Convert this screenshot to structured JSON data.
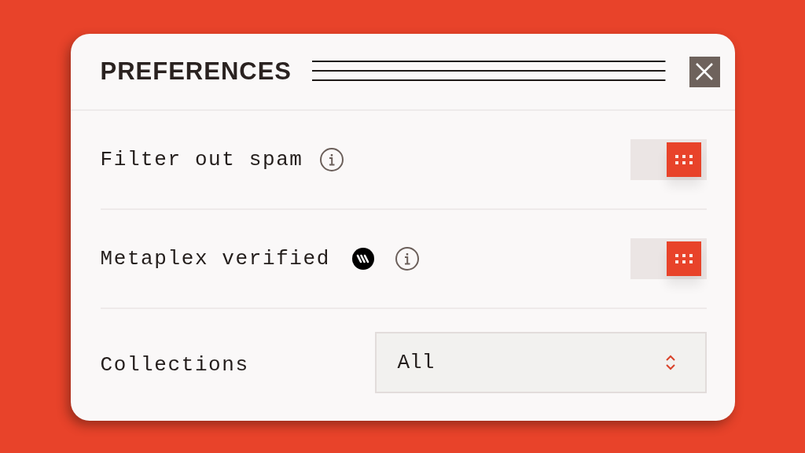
{
  "dialog": {
    "title": "PREFERENCES"
  },
  "settings": [
    {
      "kind": "toggle",
      "label": "Filter out spam",
      "badge": false,
      "info": true,
      "on": true
    },
    {
      "kind": "toggle",
      "label": "Metaplex verified",
      "badge": true,
      "info": true,
      "on": true
    },
    {
      "kind": "select",
      "label": "Collections",
      "value": "All"
    }
  ]
}
